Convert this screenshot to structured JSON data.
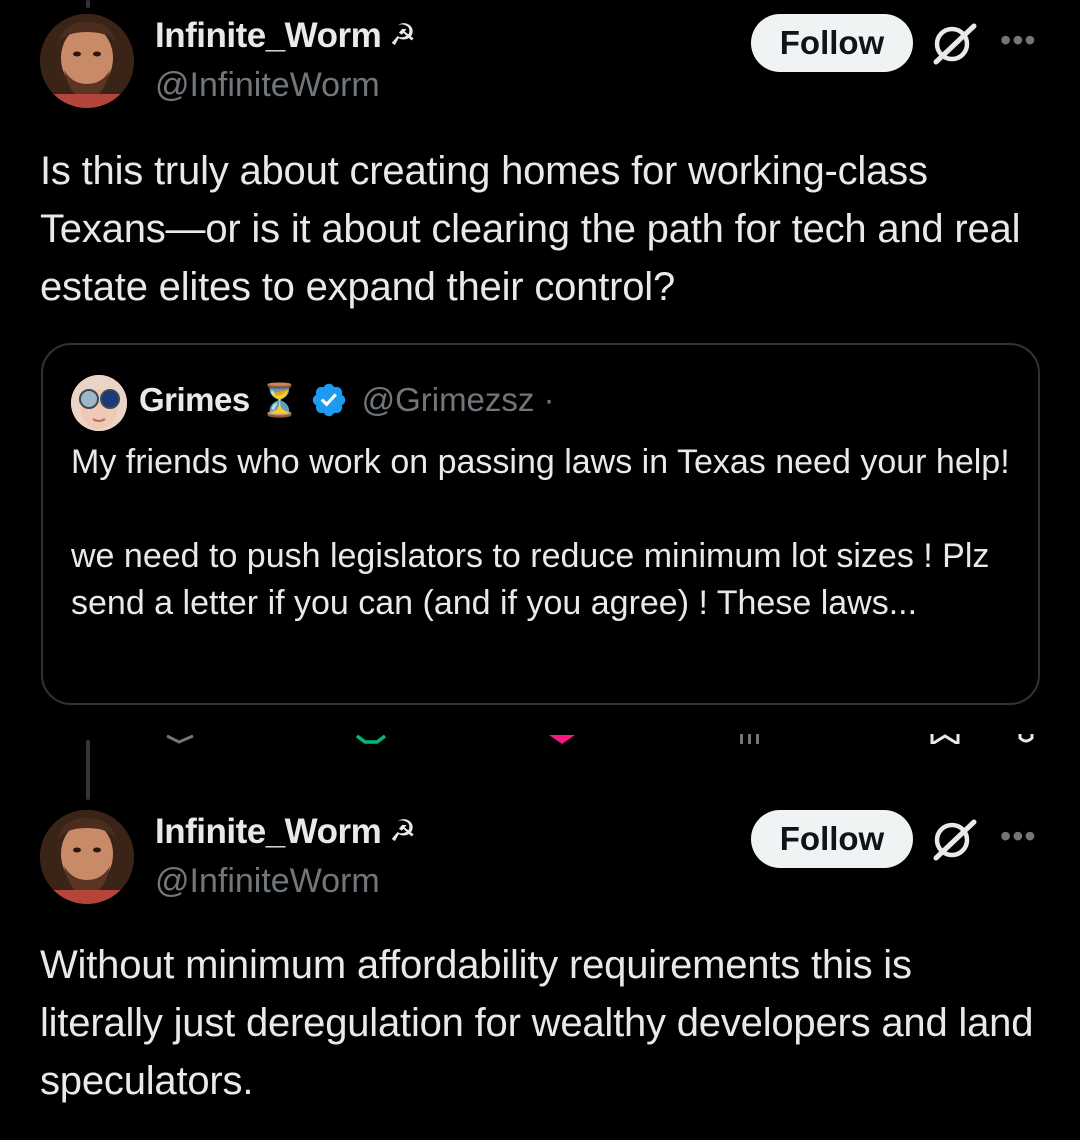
{
  "post1": {
    "display_name": "Infinite_Worm",
    "name_emoji": "☭",
    "handle": "@InfiniteWorm",
    "follow_label": "Follow",
    "more_label": "•••",
    "text": "Is this truly about creating homes for working-class Texans—or is it about clearing the path for tech and real estate elites to expand their control?"
  },
  "quote": {
    "display_name": "Grimes",
    "name_emoji": "⏳",
    "handle": "@Grimezsz ·",
    "text_p1": "My friends who work on passing laws in Texas need your help!",
    "text_p2": "we need to push legislators to reduce minimum lot sizes ! Plz send a letter if you can (and if you agree) !  These laws..."
  },
  "post2": {
    "display_name": "Infinite_Worm",
    "name_emoji": "☭",
    "handle": "@InfiniteWorm",
    "follow_label": "Follow",
    "more_label": "•••",
    "text": "Without minimum affordability requirements this is literally just deregulation for wealthy developers and land speculators."
  },
  "colors": {
    "background": "#000000",
    "text_primary": "#e7e9ea",
    "text_secondary": "#71767b",
    "border": "#2f3336",
    "follow_bg": "#eff3f4",
    "verified_blue": "#1d9bf0",
    "repost_green": "#00ba7c",
    "like_pink": "#f91880"
  }
}
